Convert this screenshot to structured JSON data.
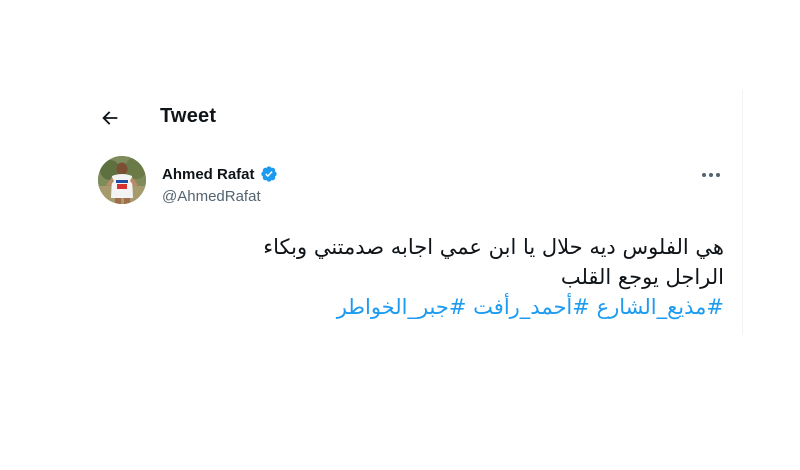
{
  "header": {
    "title": "Tweet",
    "back_icon": "arrow-left-icon"
  },
  "author": {
    "name": "Ahmed Rafat",
    "handle": "@AhmedRafat",
    "verified_icon": "verified-badge-icon",
    "verified_color": "#1d9bf0",
    "avatar_icon": "profile-photo"
  },
  "more_icon": "more-horizontal-icon",
  "tweet": {
    "lines": [
      "هي الفلوس ديه حلال يا ابن عمي اجابه صدمتني وبكاء",
      "الراجل يوجع القلب"
    ],
    "hashtags": [
      "#مذيع_الشارع",
      "#أحمد_رأفت",
      "#جبر_الخواطر"
    ]
  },
  "colors": {
    "text": "#0f1419",
    "secondary": "#536471",
    "link": "#1d9bf0"
  }
}
